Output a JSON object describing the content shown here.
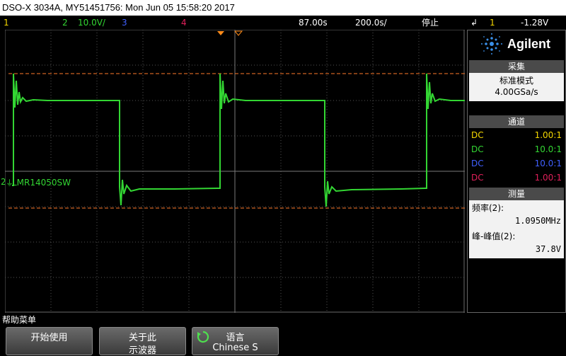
{
  "title": "DSO-X 3034A, MY51451756: Mon Jun 05 15:58:20 2017",
  "topbar": {
    "ch1_num": "1",
    "ch2_num": "2",
    "ch2_scale": "10.0V/",
    "ch3_num": "3",
    "ch4_num": "4",
    "delay": "87.00s",
    "timebase": "200.0s/",
    "run_state": "停止",
    "trigger_source": "1",
    "trigger_level": "-1.28V"
  },
  "screen": {
    "ch2_marker": "2",
    "trace_label": "LMR14050SW"
  },
  "panel": {
    "brand": "Agilent",
    "acq_header": "采集",
    "acq_mode": "标准模式",
    "acq_rate": "4.00GSa/s",
    "chan_header": "通道",
    "channels": [
      {
        "coupling": "DC",
        "probe": "1.00:1",
        "color": "#f5d800"
      },
      {
        "coupling": "DC",
        "probe": "10.0:1",
        "color": "#33d633"
      },
      {
        "coupling": "DC",
        "probe": "10.0:1",
        "color": "#4060ff"
      },
      {
        "coupling": "DC",
        "probe": "1.00:1",
        "color": "#e0205a"
      }
    ],
    "meas_header": "测量",
    "meas1_label": "频率(2):",
    "meas1_value": "1.0950MHz",
    "meas2_label": "峰-峰值(2):",
    "meas2_value": "37.8V"
  },
  "help_menu": "帮助菜单",
  "softkeys": {
    "start_line1": "开始使用",
    "about_line1": "关于此",
    "about_line2": "示波器",
    "lang_line1": "语言",
    "lang_line2": "Chinese S"
  },
  "colors": {
    "ch1": "#f5d800",
    "ch2": "#33d633",
    "ch3": "#4060ff",
    "ch4": "#e0205a",
    "cursor": "#ff7a2a"
  }
}
